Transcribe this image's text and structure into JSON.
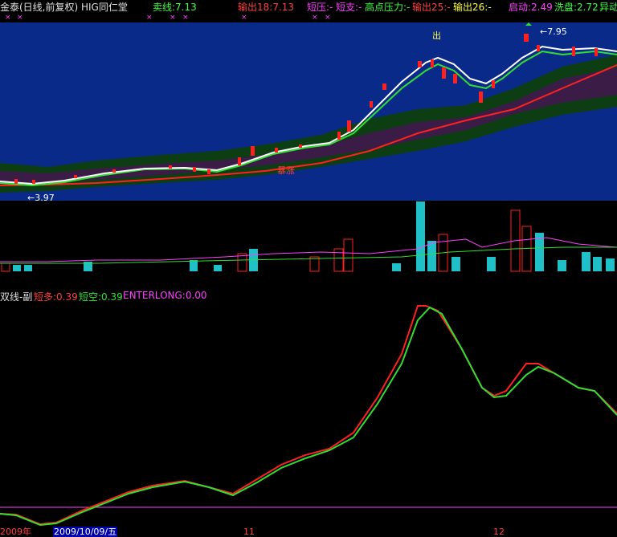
{
  "header": {
    "title": "金泰(日线,前复权) HIG同仁堂",
    "sell_line": "卖线:7.13",
    "output18": "输出18:7.13",
    "short_press": "短压:-",
    "short_support": "短支:-",
    "high_pressure": "高点压力:-",
    "output25": "输出25:-",
    "output26": "输出26:-",
    "start": "启动:2.49",
    "wash": "洗盘:2.72",
    "extra": "异动"
  },
  "markers": {
    "sell_label": "出",
    "low_price": "3.97",
    "high_price": "7.95",
    "storm_label": "暴涨"
  },
  "sub": {
    "name": "双线-副",
    "short_long": "短多:0.39",
    "short_empty": "短空:0.39",
    "enterlong": "ENTERLONG:0.00"
  },
  "dates": {
    "left_year": "2009年",
    "current": "2009/10/09/五",
    "mid": "11",
    "right": "12"
  },
  "colors": {
    "background": "#000000",
    "chart_bg": "#0a2a8a",
    "up": "#ff2020",
    "cyan": "#20c0c8",
    "green": "#30e030",
    "magenta": "#ff40ff"
  }
}
